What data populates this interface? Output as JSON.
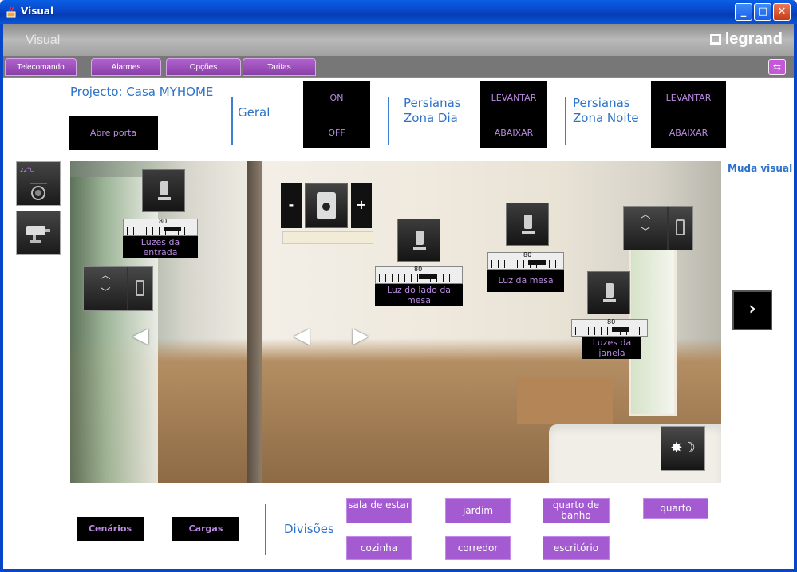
{
  "window": {
    "title": "Visual"
  },
  "header": {
    "app_name": "Visual",
    "logo_text": "legrand"
  },
  "tabs": [
    "Telecomando",
    "Alarmes",
    "Opções",
    "Tarifas"
  ],
  "top": {
    "project_title": "Projecto: Casa MYHOME",
    "open_door": "Abre porta",
    "geral_label": "Geral",
    "geral_on": "ON",
    "geral_off": "OFF",
    "zona_dia_label": "Persianas Zona Dia",
    "zona_dia_up": "LEVANTAR",
    "zona_dia_down": "ABAIXAR",
    "zona_noite_label": "Persianas Zona Noite",
    "zona_noite_up": "LEVANTAR",
    "zona_noite_down": "ABAIXAR"
  },
  "side": {
    "temp_readout": "22°C",
    "muda_visual": "Muda visual"
  },
  "lights": [
    {
      "label": "Luzes da entrada",
      "level": "80"
    },
    {
      "label": "Luz do lado da mesa",
      "level": "80"
    },
    {
      "label": "Luz da mesa",
      "level": "80"
    },
    {
      "label": "Luzes da janela",
      "level": "80"
    }
  ],
  "audio": {
    "minus": "-",
    "plus": "+"
  },
  "bottom": {
    "cenarios": "Cenários",
    "cargas": "Cargas",
    "divisoes_label": "Divisões",
    "rooms": [
      "sala de estar",
      "jardim",
      "quarto de banho",
      "quarto",
      "cozinha",
      "corredor",
      "escritório"
    ]
  },
  "colors": {
    "accent": "#a45bd1",
    "title_blue": "#2d73c9",
    "button_text": "#b98ae0"
  }
}
